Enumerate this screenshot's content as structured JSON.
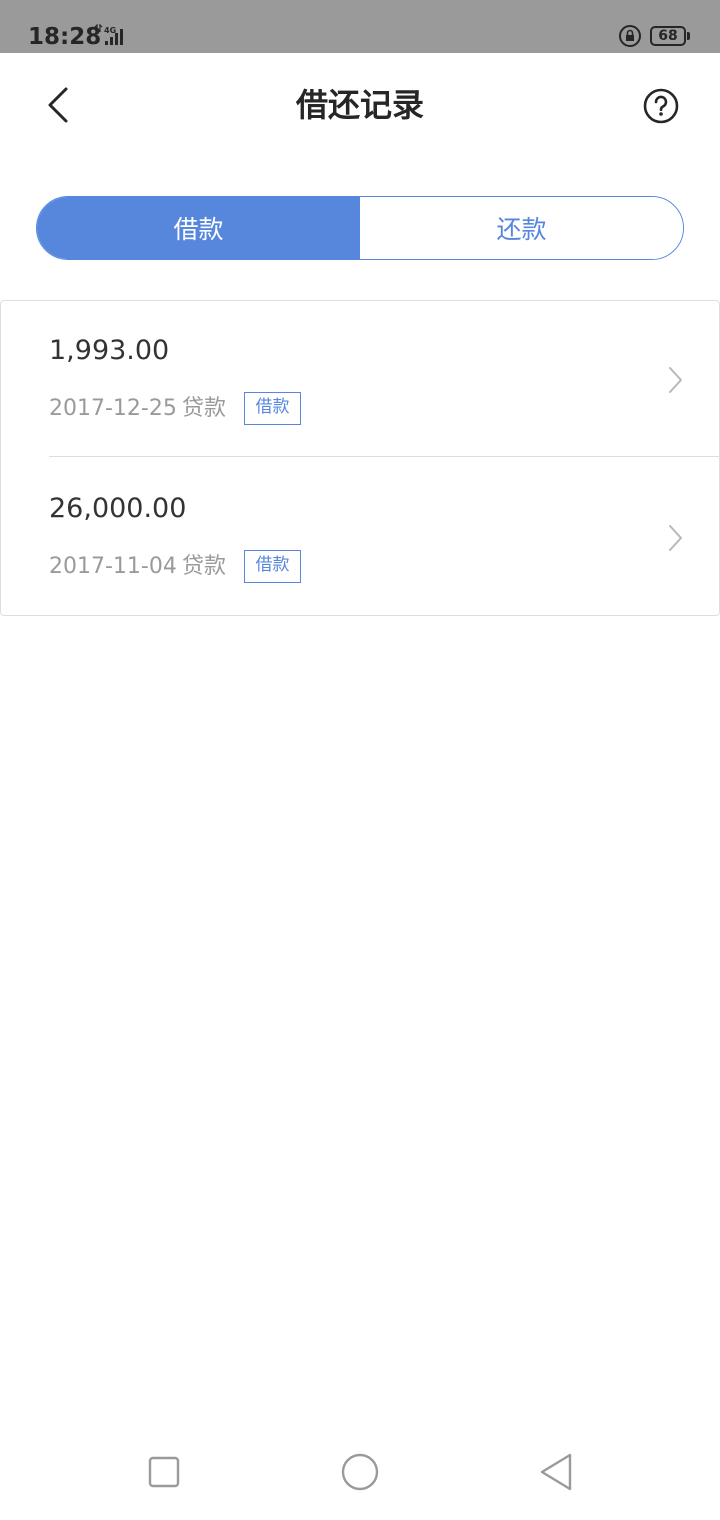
{
  "status_bar": {
    "time": "18:28",
    "network": "4G",
    "battery": "68"
  },
  "header": {
    "title": "借还记录",
    "back_icon": "chevron-left-icon",
    "help_icon": "question-circle-icon"
  },
  "tabs": [
    {
      "label": "借款",
      "active": true
    },
    {
      "label": "还款",
      "active": false
    }
  ],
  "records": [
    {
      "amount": "1,993.00",
      "date": "2017-12-25",
      "type": "贷款",
      "tag": "借款"
    },
    {
      "amount": "26,000.00",
      "date": "2017-11-04",
      "type": "贷款",
      "tag": "借款"
    }
  ],
  "colors": {
    "accent": "#5787dd",
    "text_primary": "#333333",
    "text_secondary": "#9a9a9a",
    "status_bar_bg": "#9a9a9a"
  },
  "system_nav": [
    "recents-square-icon",
    "home-circle-icon",
    "back-triangle-icon"
  ]
}
